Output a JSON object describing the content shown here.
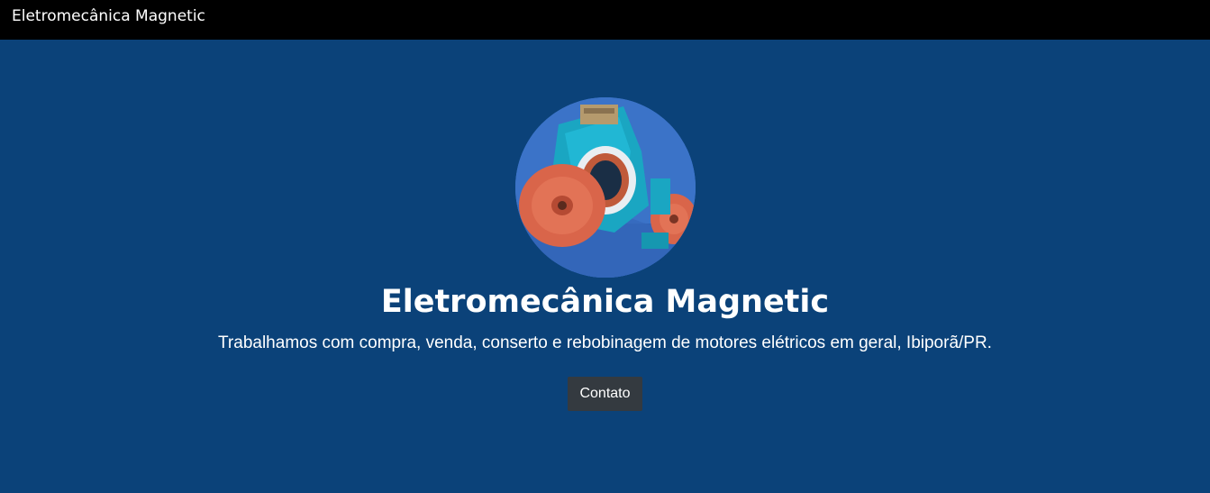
{
  "navbar": {
    "brand": "Eletromecânica Magnetic"
  },
  "hero": {
    "image_alt": "electric-motor-photo",
    "title": "Eletromecânica Magnetic",
    "description": "Trabalhamos com compra, venda, conserto e rebobinagem de motores elétricos em geral, Ibiporã/PR.",
    "button_label": "Contato"
  },
  "colors": {
    "navbar_bg": "#000000",
    "hero_bg": "#0b4279",
    "button_bg": "#343a40",
    "text": "#ffffff"
  }
}
